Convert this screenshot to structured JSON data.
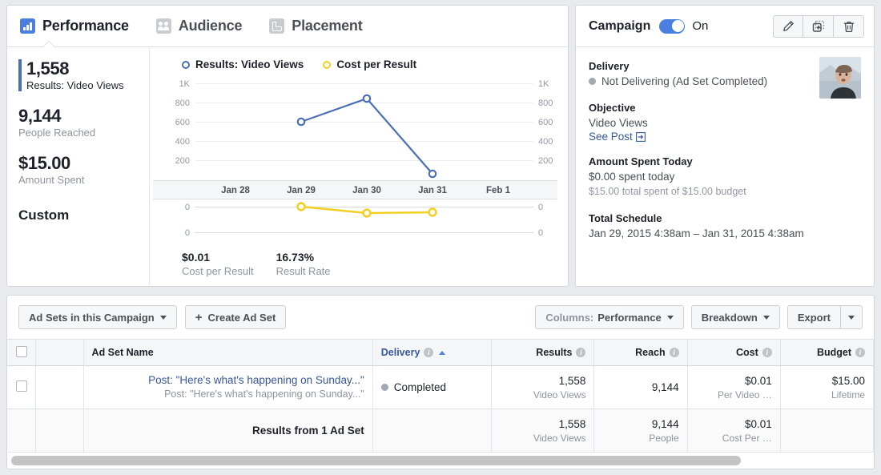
{
  "tabs": [
    {
      "label": "Performance",
      "icon": "bar-chart-icon",
      "active": true
    },
    {
      "label": "Audience",
      "icon": "people-icon",
      "active": false
    },
    {
      "label": "Placement",
      "icon": "placement-icon",
      "active": false
    }
  ],
  "stats": [
    {
      "value": "1,558",
      "label": "Results: Video Views"
    },
    {
      "value": "9,144",
      "label": "People Reached"
    },
    {
      "value": "$15.00",
      "label": "Amount Spent"
    }
  ],
  "custom_label": "Custom",
  "chart_data": {
    "type": "line",
    "title": "",
    "xlabel": "",
    "ylabel": "",
    "grid": true,
    "legend_position": "top",
    "categories": [
      "Jan 28",
      "Jan 29",
      "Jan 30",
      "Jan 31",
      "Feb 1"
    ],
    "axes": [
      {
        "name": "results",
        "ylabel": "Results: Video Views",
        "ticks": [
          "1K",
          "800",
          "600",
          "400",
          "200"
        ],
        "tick_values": [
          1000,
          800,
          600,
          400,
          200
        ],
        "ylim": [
          0,
          1000
        ]
      },
      {
        "name": "cost",
        "ylabel": "Cost per Result",
        "ticks": [
          "0",
          "0"
        ],
        "tick_values": [
          0,
          0
        ],
        "ylim": [
          0,
          0
        ]
      }
    ],
    "series": [
      {
        "name": "Results: Video Views",
        "color": "#4a6fb5",
        "axis": "results",
        "x": [
          "Jan 29",
          "Jan 30",
          "Jan 31"
        ],
        "values": [
          595,
          888,
          103
        ]
      },
      {
        "name": "Cost per Result",
        "color": "#f2d024",
        "axis": "cost",
        "x": [
          "Jan 29",
          "Jan 30",
          "Jan 31"
        ],
        "values": [
          0.0,
          0.01,
          0.01
        ]
      }
    ]
  },
  "chart_footer": [
    {
      "value": "$0.01",
      "label": "Cost per Result"
    },
    {
      "value": "16.73%",
      "label": "Result Rate"
    }
  ],
  "campaign": {
    "title": "Campaign",
    "toggle_state": "On",
    "actions": [
      {
        "name": "edit-button",
        "icon": "pencil-icon"
      },
      {
        "name": "duplicate-button",
        "icon": "duplicate-icon"
      },
      {
        "name": "delete-button",
        "icon": "trash-icon"
      }
    ],
    "delivery_heading": "Delivery",
    "delivery_status": "Not Delivering (Ad Set Completed)",
    "objective_heading": "Objective",
    "objective_value": "Video Views",
    "see_post": "See Post",
    "spend_heading": "Amount Spent Today",
    "spend_today": "$0.00 spent today",
    "spend_total": "$15.00 total spent of $15.00 budget",
    "schedule_heading": "Total Schedule",
    "schedule_value": "Jan 29, 2015 4:38am – Jan 31, 2015 4:38am"
  },
  "toolbar": {
    "scope_label": "Ad Sets in this Campaign",
    "create_label": "Create Ad Set",
    "create_plus": "+",
    "columns_prefix": "Columns:",
    "columns_value": "Performance",
    "breakdown_label": "Breakdown",
    "export_label": "Export"
  },
  "table": {
    "columns": [
      {
        "label": "Ad Set Name",
        "info": false,
        "link": false
      },
      {
        "label": "Delivery",
        "info": true,
        "link": true,
        "sorted": true
      },
      {
        "label": "Results",
        "info": true,
        "link": false
      },
      {
        "label": "Reach",
        "info": true,
        "link": false
      },
      {
        "label": "Cost",
        "info": true,
        "link": false
      },
      {
        "label": "Budget",
        "info": true,
        "link": false
      }
    ],
    "rows": [
      {
        "name": "Post: \"Here's what's happening on Sunday...\"",
        "subname": "Post: \"Here's what's happening on Sunday...\"",
        "delivery": "Completed",
        "results": "1,558",
        "results_sub": "Video Views",
        "reach": "9,144",
        "reach_sub": "",
        "cost": "$0.01",
        "cost_sub": "Per Video …",
        "budget": "$15.00",
        "budget_sub": "Lifetime",
        "toggle_on": true
      }
    ],
    "total": {
      "label": "Results from 1 Ad Set",
      "results": "1,558",
      "results_sub": "Video Views",
      "reach": "9,144",
      "reach_sub": "People",
      "cost": "$0.01",
      "cost_sub": "Cost Per …",
      "budget": "",
      "budget_sub": ""
    }
  },
  "colors": {
    "accent_blue": "#4a7fe0",
    "link_blue": "#365899",
    "series_blue": "#4a6fb5",
    "series_yellow": "#f2d024",
    "muted": "#8d949e"
  }
}
